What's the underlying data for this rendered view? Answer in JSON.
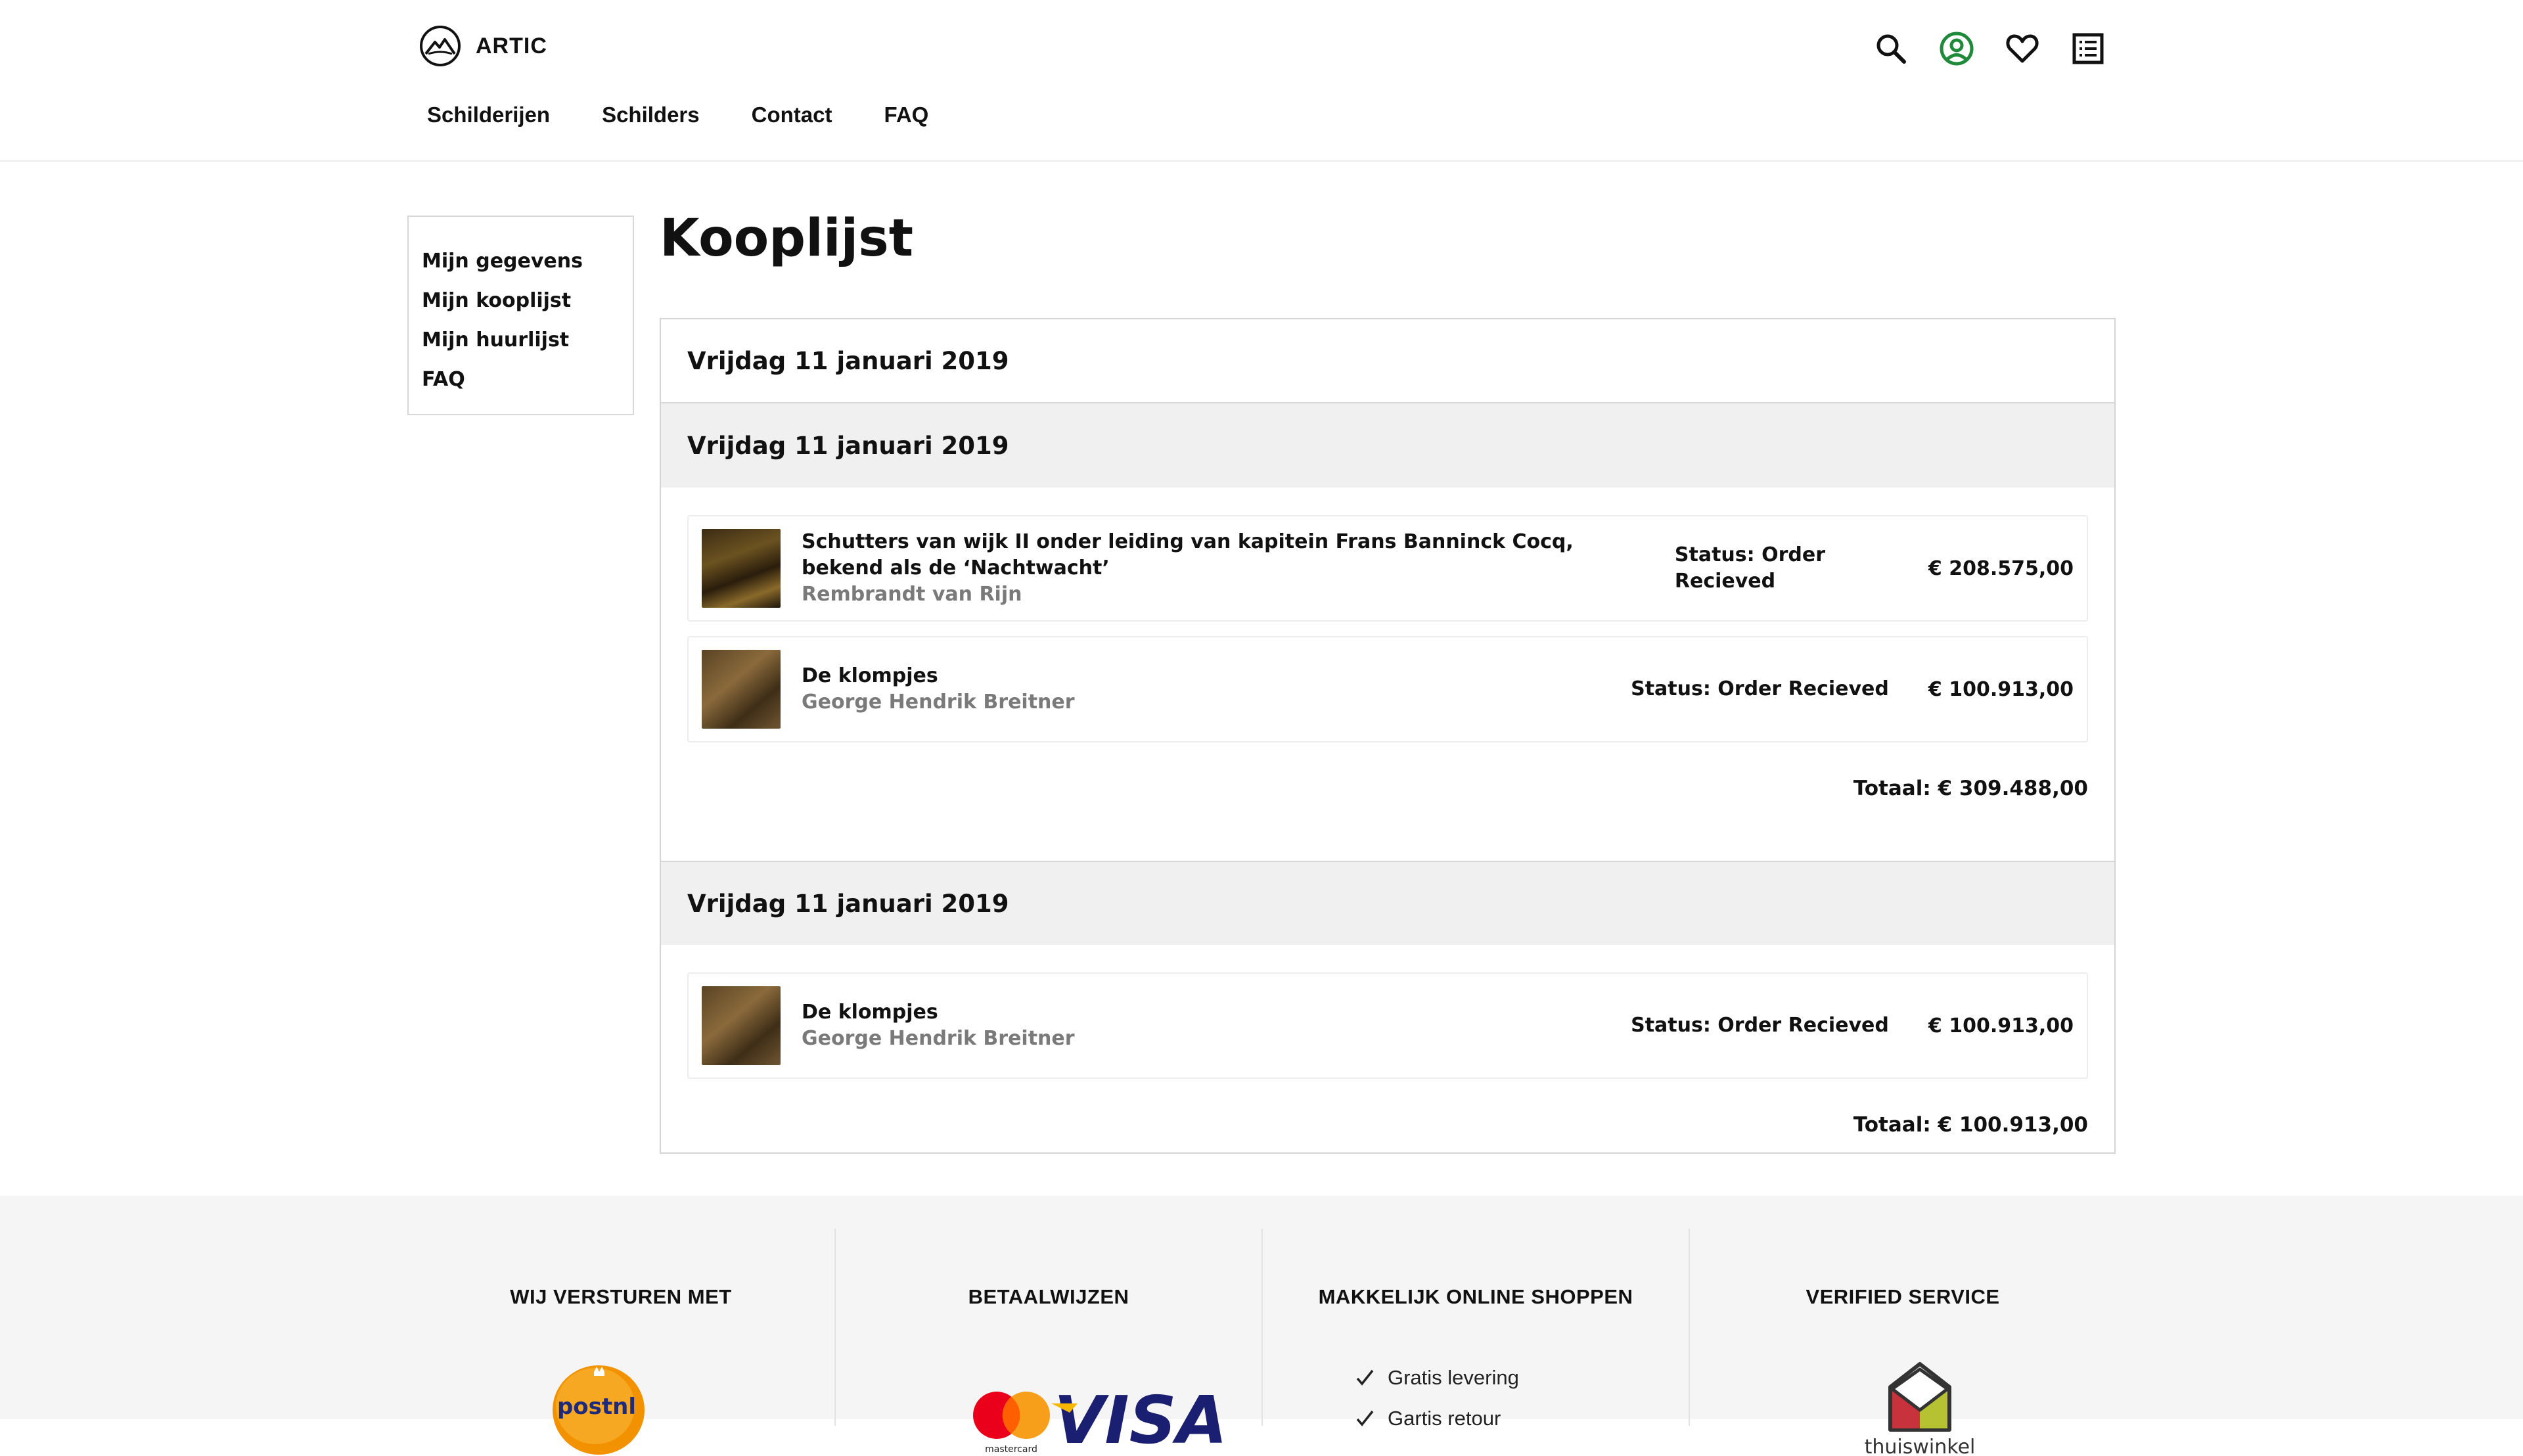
{
  "brand": {
    "name": "ARTIC"
  },
  "nav": [
    "Schilderijen",
    "Schilders",
    "Contact",
    "FAQ"
  ],
  "header_icons": [
    "search-icon",
    "account-icon",
    "wishlist-heart-icon",
    "list-icon"
  ],
  "colors": {
    "accent_green": "#1f8a3a",
    "grey_band": "#f0f0f0",
    "muted_text": "#7a7a7a"
  },
  "sidebar": [
    "Mijn gegevens",
    "Mijn kooplijst",
    "Mijn huurlijst",
    "FAQ"
  ],
  "page_title": "Kooplijst",
  "orders": [
    {
      "date": "Vrijdag 11 januari 2019"
    },
    {
      "date": "Vrijdag 11 januari 2019",
      "items": [
        {
          "title": "Schutters van wijk II onder leiding van kapitein Frans Banninck Cocq, bekend als de ‘Nachtwacht’",
          "artist": "Rembrandt van Rijn",
          "status": "Status: Order Recieved",
          "price": "€ 208.575,00"
        },
        {
          "title": "De klompjes",
          "artist": "George Hendrik Breitner",
          "status": "Status: Order Recieved",
          "price": "€ 100.913,00"
        }
      ],
      "total": "Totaal: € 309.488,00"
    },
    {
      "date": "Vrijdag 11 januari 2019",
      "items": [
        {
          "title": "De klompjes",
          "artist": "George Hendrik Breitner",
          "status": "Status: Order Recieved",
          "price": "€ 100.913,00"
        }
      ],
      "total": "Totaal: € 100.913,00"
    }
  ],
  "footer": {
    "shipping": {
      "title": "WIJ VERSTUREN MET",
      "logo_text": "postnl"
    },
    "payment": {
      "title": "BETAALWIJZEN",
      "visa": "VISA",
      "mastercard": "mastercard"
    },
    "shopping": {
      "title": "MAKKELIJK ONLINE SHOPPEN",
      "items": [
        "Gratis levering",
        "Gartis retour"
      ]
    },
    "verified": {
      "title": "VERIFIED SERVICE",
      "logo_text": "thuiswinkel"
    }
  }
}
